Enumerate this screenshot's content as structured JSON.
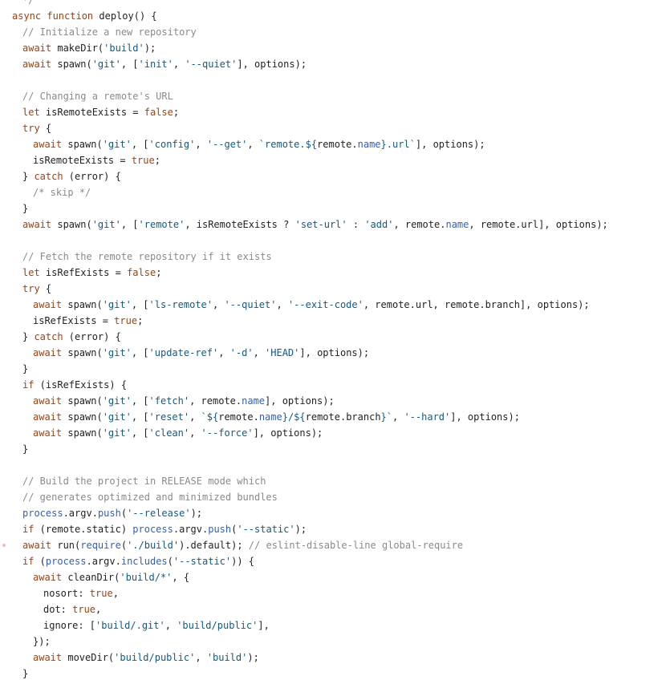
{
  "colors": {
    "background": "#ffffff",
    "keyword": "#a0420b",
    "string": "#0d5b8a",
    "comment": "#8a8a8a",
    "property": "#2f5fc0",
    "plain": "#222222",
    "gutter_marker": "#f3b6c8"
  },
  "code": {
    "lines": [
      {
        "indent": 1,
        "tokens": [
          [
            "com",
            "*/"
          ]
        ]
      },
      {
        "indent": 0,
        "tokens": [
          [
            "kw",
            "async function"
          ],
          [
            "plain",
            " deploy() {"
          ]
        ]
      },
      {
        "indent": 1,
        "tokens": [
          [
            "com",
            "// Initialize a new repository"
          ]
        ]
      },
      {
        "indent": 1,
        "tokens": [
          [
            "kw",
            "await"
          ],
          [
            "plain",
            " makeDir("
          ],
          [
            "str",
            "'build'"
          ],
          [
            "plain",
            ");"
          ]
        ]
      },
      {
        "indent": 1,
        "tokens": [
          [
            "kw",
            "await"
          ],
          [
            "plain",
            " spawn("
          ],
          [
            "str",
            "'git'"
          ],
          [
            "plain",
            ", ["
          ],
          [
            "str",
            "'init'"
          ],
          [
            "plain",
            ", "
          ],
          [
            "str",
            "'--quiet'"
          ],
          [
            "plain",
            "], options);"
          ]
        ]
      },
      {
        "indent": 0,
        "tokens": []
      },
      {
        "indent": 1,
        "tokens": [
          [
            "com",
            "// Changing a remote's URL"
          ]
        ]
      },
      {
        "indent": 1,
        "tokens": [
          [
            "kw",
            "let"
          ],
          [
            "plain",
            " isRemoteExists = "
          ],
          [
            "kw",
            "false"
          ],
          [
            "plain",
            ";"
          ]
        ]
      },
      {
        "indent": 1,
        "tokens": [
          [
            "kw",
            "try"
          ],
          [
            "plain",
            " {"
          ]
        ]
      },
      {
        "indent": 2,
        "tokens": [
          [
            "kw",
            "await"
          ],
          [
            "plain",
            " spawn("
          ],
          [
            "str",
            "'git'"
          ],
          [
            "plain",
            ", ["
          ],
          [
            "str",
            "'config'"
          ],
          [
            "plain",
            ", "
          ],
          [
            "str",
            "'--get'"
          ],
          [
            "plain",
            ", "
          ],
          [
            "str",
            "`remote.${"
          ],
          [
            "plain",
            "remote."
          ],
          [
            "prop",
            "name"
          ],
          [
            "str",
            "}.url`"
          ],
          [
            "plain",
            "], options);"
          ]
        ]
      },
      {
        "indent": 2,
        "tokens": [
          [
            "plain",
            "isRemoteExists = "
          ],
          [
            "kw",
            "true"
          ],
          [
            "plain",
            ";"
          ]
        ]
      },
      {
        "indent": 1,
        "tokens": [
          [
            "plain",
            "} "
          ],
          [
            "kw",
            "catch"
          ],
          [
            "plain",
            " (error) {"
          ]
        ]
      },
      {
        "indent": 2,
        "tokens": [
          [
            "com",
            "/* skip */"
          ]
        ]
      },
      {
        "indent": 1,
        "tokens": [
          [
            "plain",
            "}"
          ]
        ]
      },
      {
        "indent": 1,
        "tokens": [
          [
            "kw",
            "await"
          ],
          [
            "plain",
            " spawn("
          ],
          [
            "str",
            "'git'"
          ],
          [
            "plain",
            ", ["
          ],
          [
            "str",
            "'remote'"
          ],
          [
            "plain",
            ", isRemoteExists ? "
          ],
          [
            "str",
            "'set-url'"
          ],
          [
            "plain",
            " : "
          ],
          [
            "str",
            "'add'"
          ],
          [
            "plain",
            ", remote."
          ],
          [
            "prop",
            "name"
          ],
          [
            "plain",
            ", remote.url], options);"
          ]
        ]
      },
      {
        "indent": 0,
        "tokens": []
      },
      {
        "indent": 1,
        "tokens": [
          [
            "com",
            "// Fetch the remote repository if it exists"
          ]
        ]
      },
      {
        "indent": 1,
        "tokens": [
          [
            "kw",
            "let"
          ],
          [
            "plain",
            " isRefExists = "
          ],
          [
            "kw",
            "false"
          ],
          [
            "plain",
            ";"
          ]
        ]
      },
      {
        "indent": 1,
        "tokens": [
          [
            "kw",
            "try"
          ],
          [
            "plain",
            " {"
          ]
        ]
      },
      {
        "indent": 2,
        "tokens": [
          [
            "kw",
            "await"
          ],
          [
            "plain",
            " spawn("
          ],
          [
            "str",
            "'git'"
          ],
          [
            "plain",
            ", ["
          ],
          [
            "str",
            "'ls-remote'"
          ],
          [
            "plain",
            ", "
          ],
          [
            "str",
            "'--quiet'"
          ],
          [
            "plain",
            ", "
          ],
          [
            "str",
            "'--exit-code'"
          ],
          [
            "plain",
            ", remote.url, remote.branch], options);"
          ]
        ]
      },
      {
        "indent": 2,
        "tokens": [
          [
            "plain",
            "isRefExists = "
          ],
          [
            "kw",
            "true"
          ],
          [
            "plain",
            ";"
          ]
        ]
      },
      {
        "indent": 1,
        "tokens": [
          [
            "plain",
            "} "
          ],
          [
            "kw",
            "catch"
          ],
          [
            "plain",
            " (error) {"
          ]
        ]
      },
      {
        "indent": 2,
        "tokens": [
          [
            "kw",
            "await"
          ],
          [
            "plain",
            " spawn("
          ],
          [
            "str",
            "'git'"
          ],
          [
            "plain",
            ", ["
          ],
          [
            "str",
            "'update-ref'"
          ],
          [
            "plain",
            ", "
          ],
          [
            "str",
            "'-d'"
          ],
          [
            "plain",
            ", "
          ],
          [
            "str",
            "'HEAD'"
          ],
          [
            "plain",
            "], options);"
          ]
        ]
      },
      {
        "indent": 1,
        "tokens": [
          [
            "plain",
            "}"
          ]
        ]
      },
      {
        "indent": 1,
        "tokens": [
          [
            "kw",
            "if"
          ],
          [
            "plain",
            " (isRefExists) {"
          ]
        ]
      },
      {
        "indent": 2,
        "tokens": [
          [
            "kw",
            "await"
          ],
          [
            "plain",
            " spawn("
          ],
          [
            "str",
            "'git'"
          ],
          [
            "plain",
            ", ["
          ],
          [
            "str",
            "'fetch'"
          ],
          [
            "plain",
            ", remote."
          ],
          [
            "prop",
            "name"
          ],
          [
            "plain",
            "], options);"
          ]
        ]
      },
      {
        "indent": 2,
        "tokens": [
          [
            "kw",
            "await"
          ],
          [
            "plain",
            " spawn("
          ],
          [
            "str",
            "'git'"
          ],
          [
            "plain",
            ", ["
          ],
          [
            "str",
            "'reset'"
          ],
          [
            "plain",
            ", "
          ],
          [
            "str",
            "`${"
          ],
          [
            "plain",
            "remote."
          ],
          [
            "prop",
            "name"
          ],
          [
            "str",
            "}/${"
          ],
          [
            "plain",
            "remote.branch"
          ],
          [
            "str",
            "}`"
          ],
          [
            "plain",
            ", "
          ],
          [
            "str",
            "'--hard'"
          ],
          [
            "plain",
            "], options);"
          ]
        ]
      },
      {
        "indent": 2,
        "tokens": [
          [
            "kw",
            "await"
          ],
          [
            "plain",
            " spawn("
          ],
          [
            "str",
            "'git'"
          ],
          [
            "plain",
            ", ["
          ],
          [
            "str",
            "'clean'"
          ],
          [
            "plain",
            ", "
          ],
          [
            "str",
            "'--force'"
          ],
          [
            "plain",
            "], options);"
          ]
        ]
      },
      {
        "indent": 1,
        "tokens": [
          [
            "plain",
            "}"
          ]
        ]
      },
      {
        "indent": 0,
        "tokens": []
      },
      {
        "indent": 1,
        "tokens": [
          [
            "com",
            "// Build the project in RELEASE mode which"
          ]
        ]
      },
      {
        "indent": 1,
        "tokens": [
          [
            "com",
            "// generates optimized and minimized bundles"
          ]
        ]
      },
      {
        "indent": 1,
        "tokens": [
          [
            "prop",
            "process"
          ],
          [
            "plain",
            ".argv."
          ],
          [
            "prop",
            "push"
          ],
          [
            "plain",
            "("
          ],
          [
            "str",
            "'--release'"
          ],
          [
            "plain",
            ");"
          ]
        ]
      },
      {
        "indent": 1,
        "tokens": [
          [
            "kw",
            "if"
          ],
          [
            "plain",
            " (remote.static) "
          ],
          [
            "prop",
            "process"
          ],
          [
            "plain",
            ".argv."
          ],
          [
            "prop",
            "push"
          ],
          [
            "plain",
            "("
          ],
          [
            "str",
            "'--static'"
          ],
          [
            "plain",
            ");"
          ]
        ]
      },
      {
        "indent": 1,
        "marker": true,
        "tokens": [
          [
            "kw",
            "await"
          ],
          [
            "plain",
            " run("
          ],
          [
            "prop",
            "require"
          ],
          [
            "plain",
            "("
          ],
          [
            "str",
            "'./build'"
          ],
          [
            "plain",
            ").default); "
          ],
          [
            "com",
            "// eslint-disable-line global-require"
          ]
        ]
      },
      {
        "indent": 1,
        "tokens": [
          [
            "kw",
            "if"
          ],
          [
            "plain",
            " ("
          ],
          [
            "prop",
            "process"
          ],
          [
            "plain",
            ".argv."
          ],
          [
            "prop",
            "includes"
          ],
          [
            "plain",
            "("
          ],
          [
            "str",
            "'--static'"
          ],
          [
            "plain",
            ")) {"
          ]
        ]
      },
      {
        "indent": 2,
        "tokens": [
          [
            "kw",
            "await"
          ],
          [
            "plain",
            " cleanDir("
          ],
          [
            "str",
            "'build/*'"
          ],
          [
            "plain",
            ", {"
          ]
        ]
      },
      {
        "indent": 3,
        "tokens": [
          [
            "plain",
            "nosort: "
          ],
          [
            "kw",
            "true"
          ],
          [
            "plain",
            ","
          ]
        ]
      },
      {
        "indent": 3,
        "tokens": [
          [
            "plain",
            "dot: "
          ],
          [
            "kw",
            "true"
          ],
          [
            "plain",
            ","
          ]
        ]
      },
      {
        "indent": 3,
        "tokens": [
          [
            "plain",
            "ignore: ["
          ],
          [
            "str",
            "'build/.git'"
          ],
          [
            "plain",
            ", "
          ],
          [
            "str",
            "'build/public'"
          ],
          [
            "plain",
            "],"
          ]
        ]
      },
      {
        "indent": 2,
        "tokens": [
          [
            "plain",
            "});"
          ]
        ]
      },
      {
        "indent": 2,
        "tokens": [
          [
            "kw",
            "await"
          ],
          [
            "plain",
            " moveDir("
          ],
          [
            "str",
            "'build/public'"
          ],
          [
            "plain",
            ", "
          ],
          [
            "str",
            "'build'"
          ],
          [
            "plain",
            ");"
          ]
        ]
      },
      {
        "indent": 1,
        "tokens": [
          [
            "plain",
            "}"
          ]
        ]
      }
    ]
  }
}
